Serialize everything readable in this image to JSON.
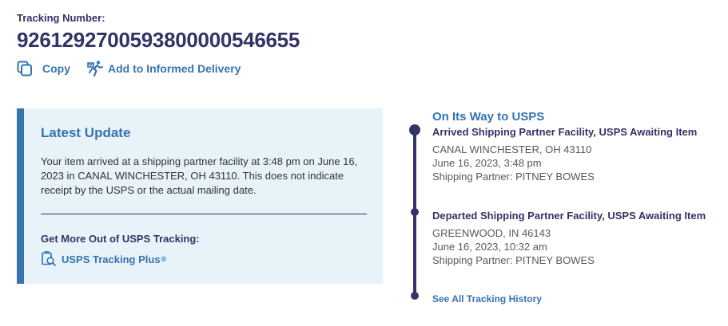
{
  "header": {
    "tracking_label": "Tracking Number:",
    "tracking_number": "9261292700593800000546655"
  },
  "actions": {
    "copy_label": "Copy",
    "informed_delivery_label": "Add to Informed Delivery"
  },
  "latest_update": {
    "title": "Latest Update",
    "text": "Your item arrived at a shipping partner facility at 3:48 pm on June 16, 2023 in CANAL WINCHESTER, OH 43110. This does not indicate receipt by the USPS or the actual mailing date.",
    "more_title": "Get More Out of USPS Tracking:",
    "plus_label": "USPS Tracking Plus",
    "plus_mark": "®"
  },
  "timeline": {
    "status": "On Its Way to USPS",
    "events": [
      {
        "title": "Arrived Shipping Partner Facility, USPS Awaiting Item",
        "location": "CANAL WINCHESTER, OH 43110",
        "datetime": "June 16, 2023, 3:48 pm",
        "partner": "Shipping Partner: PITNEY BOWES"
      },
      {
        "title": "Departed Shipping Partner Facility, USPS Awaiting Item",
        "location": "GREENWOOD, IN 46143",
        "datetime": "June 16, 2023, 10:32 am",
        "partner": "Shipping Partner: PITNEY BOWES"
      }
    ],
    "history_link": "See All Tracking History"
  },
  "colors": {
    "navy": "#333366",
    "link_blue": "#3573b1",
    "panel_bg": "#e7f3f8",
    "body_text": "#333333",
    "secondary_text": "#595959"
  },
  "icons": {
    "copy": "copy-icon",
    "informed_delivery": "informed-delivery-icon",
    "tracking_plus": "tracking-plus-icon"
  }
}
